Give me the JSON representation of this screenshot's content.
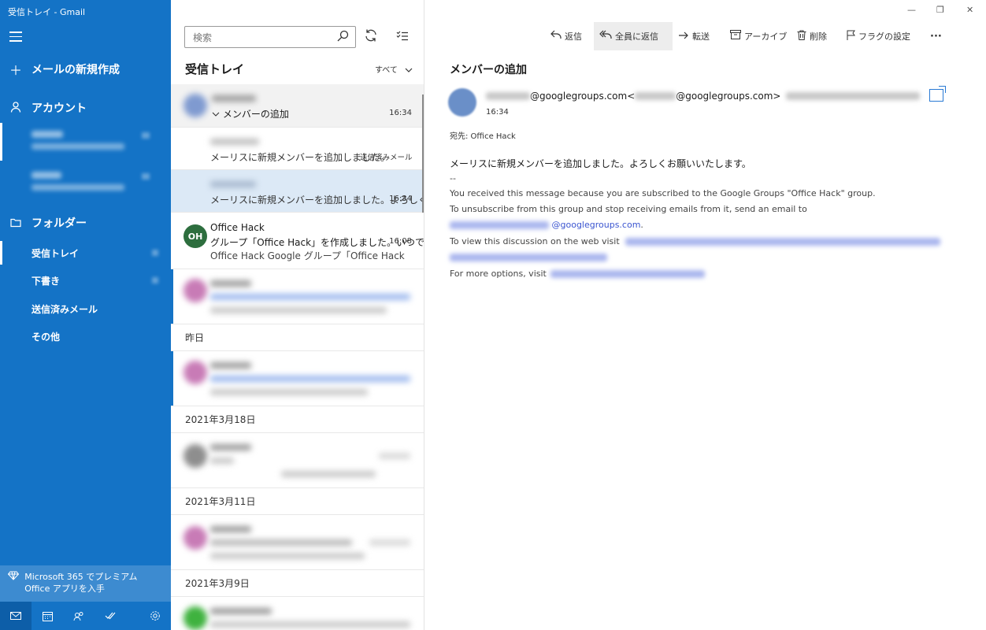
{
  "window": {
    "title": "受信トレイ - Gmail",
    "controls": {
      "minimize": "—",
      "restore": "❐",
      "close": "✕"
    }
  },
  "nav": {
    "new_mail": "メールの新規作成",
    "account_header": "アカウント",
    "folder_header": "フォルダー",
    "folders": [
      {
        "label": "受信トレイ",
        "selected": true
      },
      {
        "label": "下書き",
        "selected": false
      },
      {
        "label": "送信済みメール",
        "selected": false
      },
      {
        "label": "その他",
        "selected": false
      }
    ],
    "promo": "Microsoft 365 でプレミアム Office アプリを入手",
    "bottom_icons": [
      "mail-icon",
      "calendar-icon",
      "people-icon",
      "todo-icon",
      "settings-icon"
    ]
  },
  "list": {
    "search_placeholder": "検索",
    "title": "受信トレイ",
    "filter": "すべて",
    "messages": [
      {
        "subject": "メンバーの追加",
        "time": "16:34"
      },
      {
        "preview": "メーリスに新規メンバーを追加しました。",
        "tag": "送信済みメール"
      },
      {
        "preview": "メーリスに新規メンバーを追加しました。よろしく",
        "time": "16:34"
      },
      {
        "avatar": "OH",
        "avatar_color": "#2d6e3e",
        "sender": "Office Hack",
        "subject": "グループ「Office Hack」を作成しました。いつで",
        "time": "16:08",
        "preview": "Office Hack Google グループ「Office Hack"
      }
    ],
    "date_headers": [
      "昨日",
      "2021年3月18日",
      "2021年3月11日",
      "2021年3月9日"
    ]
  },
  "toolbar": {
    "reply": "返信",
    "reply_all": "全員に返信",
    "forward": "転送",
    "archive": "アーカイブ",
    "delete": "削除",
    "flag": "フラグの設定",
    "more": "···"
  },
  "reading": {
    "subject": "メンバーの追加",
    "from_domain": "@googlegroups.com",
    "from_mid": " <",
    "from_domain2": "@googlegroups.com>",
    "time": "16:34",
    "to": "宛先: Office Hack",
    "body_main": "メーリスに新規メンバーを追加しました。よろしくお願いいたします。",
    "separator": "--",
    "line1": "You received this message because you are subscribed to the Google Groups \"Office Hack\" group.",
    "line2": "To unsubscribe from this group and stop receiving emails from it, send an email to",
    "link_domain": "@googlegroups.com",
    "line2_end": ".",
    "line3": "To view this discussion on the web visit",
    "line4": "For more options, visit"
  },
  "colors": {
    "nav_bg": "#1473c6",
    "accent": "#1473c6",
    "selected_item_bg": "#dce9f6",
    "link": "#3b55d0"
  }
}
